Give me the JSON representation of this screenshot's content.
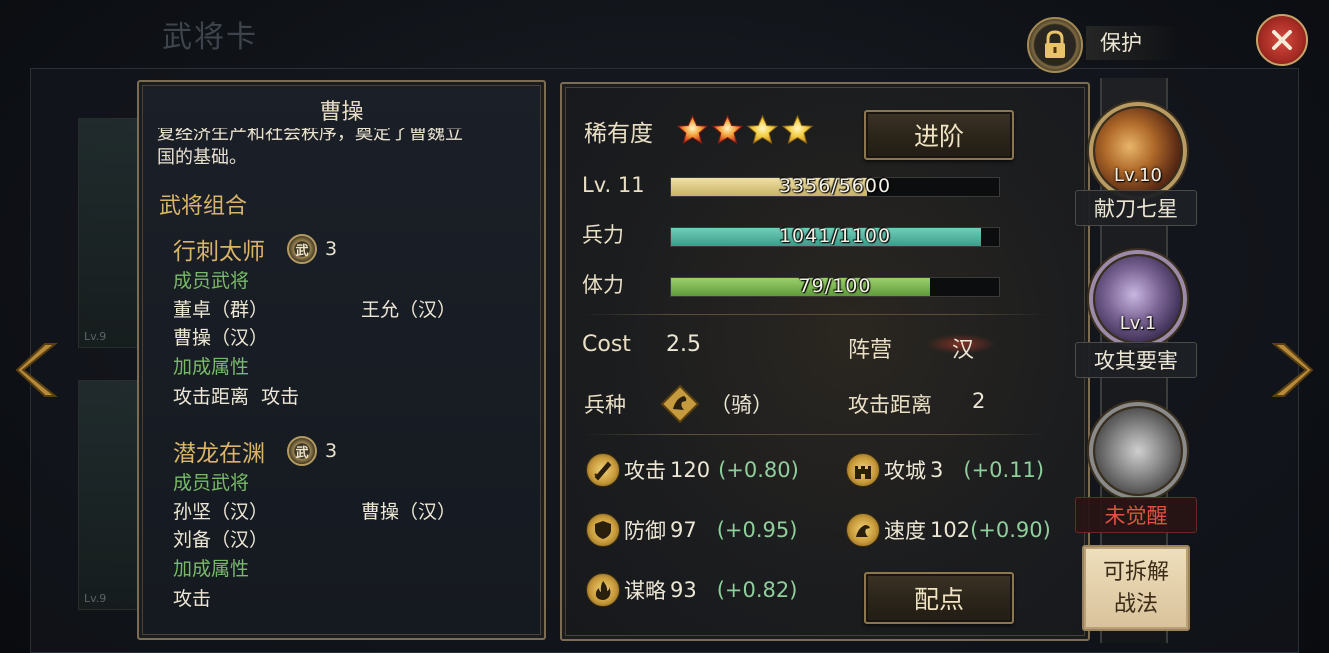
{
  "background": {
    "title": "武将卡",
    "bg_card_levels": [
      "Lv.9",
      "Lv.9"
    ]
  },
  "general": {
    "name": "曹操",
    "bio_lines": [
      "复经济生产和社会秩序，奠定了曹魏立",
      "国的基础。"
    ],
    "combos_heading": "武将组合",
    "combos": [
      {
        "name": "行刺太师",
        "badge": "武",
        "count": "3",
        "members_label": "成员武将",
        "members": [
          "董卓（群）",
          "王允（汉）",
          "曹操（汉）"
        ],
        "bonus_label": "加成属性",
        "bonus": "攻击距离  攻击"
      },
      {
        "name": "潜龙在渊",
        "badge": "武",
        "count": "3",
        "members_label": "成员武将",
        "members": [
          "孙坚（汉）",
          "曹操（汉）",
          "刘备（汉）"
        ],
        "bonus_label": "加成属性",
        "bonus": "攻击"
      }
    ]
  },
  "stats": {
    "rarity_label": "稀有度",
    "rarity_stars": 4,
    "advance_button": "进阶",
    "level_label": "Lv. 11",
    "exp_text": "3356/5600",
    "exp_fraction": 0.599,
    "troops_label": "兵力",
    "troops_text": "1041/1100",
    "troops_fraction": 0.946,
    "stamina_label": "体力",
    "stamina_text": "79/100",
    "stamina_fraction": 0.79,
    "cost_label": "Cost",
    "cost_value": "2.5",
    "faction_label": "阵营",
    "faction_value": "汉",
    "unit_label": "兵种",
    "unit_value": "（骑）",
    "range_label": "攻击距离",
    "range_value": "2",
    "attack_label": "攻击",
    "attack_value": "120",
    "attack_bonus": "(+0.80)",
    "siege_label": "攻城",
    "siege_value": "3",
    "siege_bonus": "(+0.11)",
    "defense_label": "防御",
    "defense_value": "97",
    "defense_bonus": "(+0.95)",
    "speed_label": "速度",
    "speed_value": "102",
    "speed_bonus": "(+0.90)",
    "strategy_label": "谋略",
    "strategy_value": "93",
    "strategy_bonus": "(+0.82)",
    "allocate_button": "配点"
  },
  "top": {
    "protect_label": "保护"
  },
  "skills": [
    {
      "level": "Lv.10",
      "name": "献刀七星"
    },
    {
      "level": "Lv.1",
      "name": "攻其要害"
    },
    {
      "level": "",
      "name": "未觉醒"
    }
  ],
  "detach_button": {
    "line1": "可拆解",
    "line2": "战法"
  },
  "colors": {
    "gold_text": "#d9b46a",
    "green_text": "#78b96a",
    "bonus_green": "#8fcf9b",
    "locked_red": "#e0533f"
  }
}
